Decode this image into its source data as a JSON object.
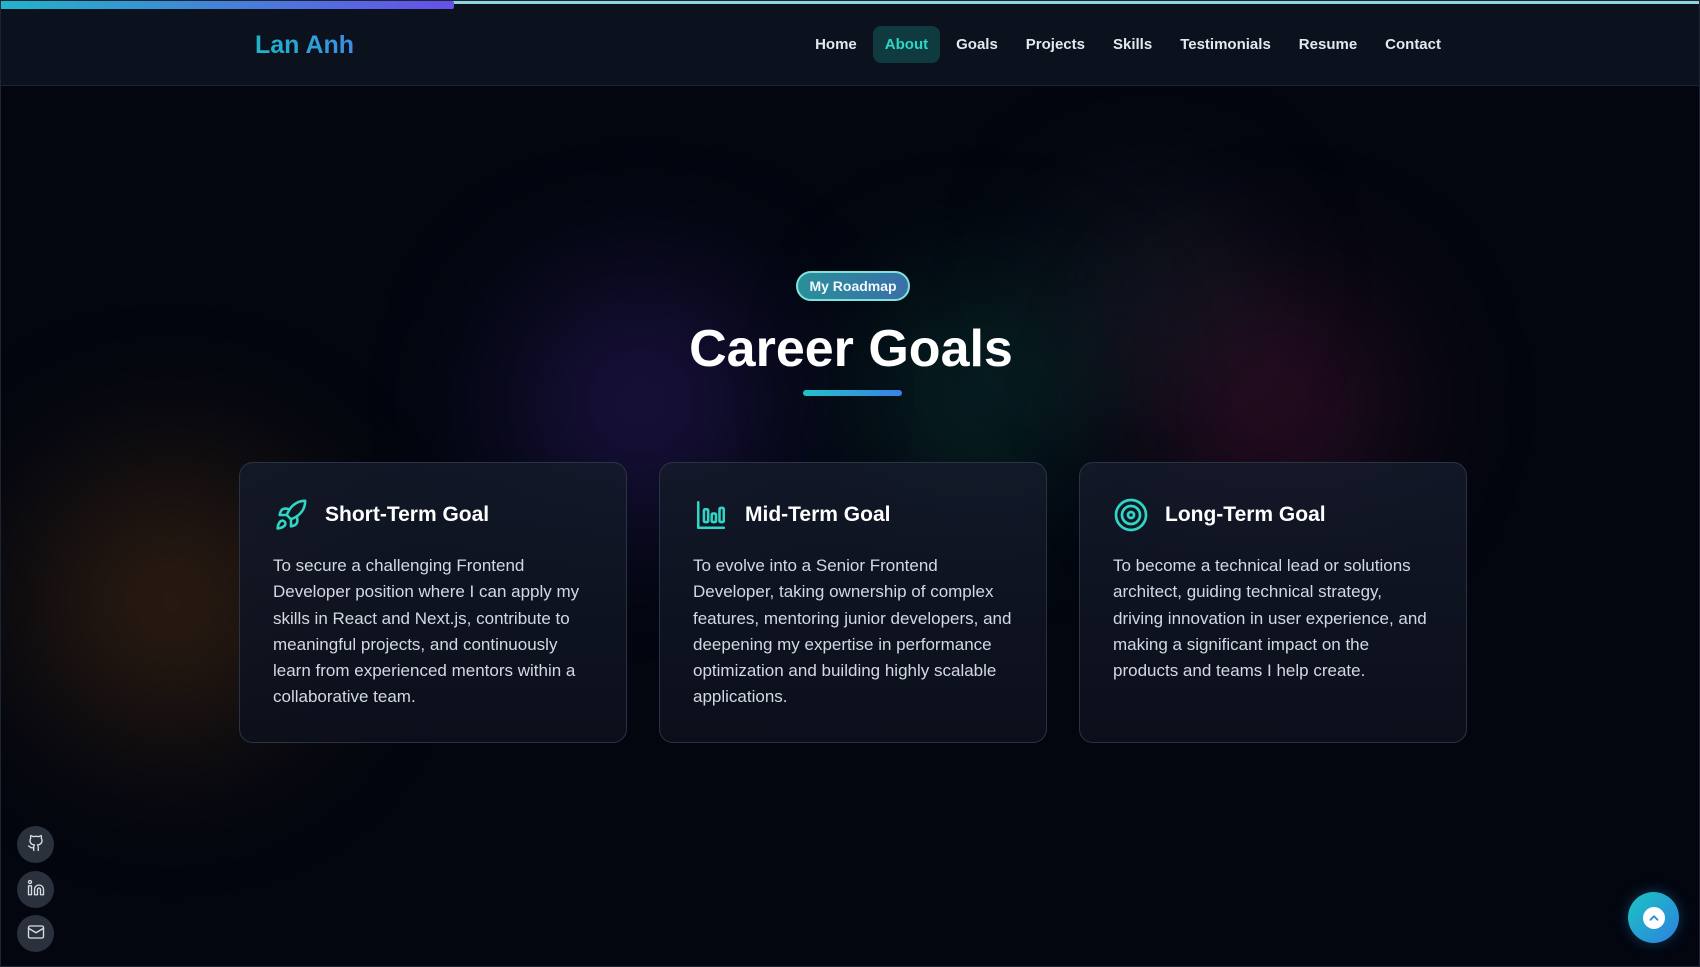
{
  "scroll_progress_percent": 26.7,
  "header": {
    "logo": "Lan Anh",
    "nav": [
      {
        "label": "Home",
        "active": false
      },
      {
        "label": "About",
        "active": true
      },
      {
        "label": "Goals",
        "active": false
      },
      {
        "label": "Projects",
        "active": false
      },
      {
        "label": "Skills",
        "active": false
      },
      {
        "label": "Testimonials",
        "active": false
      },
      {
        "label": "Resume",
        "active": false
      },
      {
        "label": "Contact",
        "active": false
      }
    ]
  },
  "section": {
    "badge": "My Roadmap",
    "title": "Career Goals"
  },
  "goals": [
    {
      "icon": "rocket-icon",
      "title": "Short-Term Goal",
      "text": "To secure a challenging Frontend Developer position where I can apply my skills in React and Next.js, contribute to meaningful projects, and continuously learn from experienced mentors within a collaborative team."
    },
    {
      "icon": "bar-chart-icon",
      "title": "Mid-Term Goal",
      "text": "To evolve into a Senior Frontend Developer, taking ownership of complex features, mentoring junior developers, and deepening my expertise in performance optimization and building highly scalable applications."
    },
    {
      "icon": "target-icon",
      "title": "Long-Term Goal",
      "text": "To become a technical lead or solutions architect, guiding technical strategy, driving innovation in user experience, and making a significant impact on the products and teams I help create."
    }
  ],
  "social": [
    {
      "icon": "github-icon"
    },
    {
      "icon": "linkedin-icon"
    },
    {
      "icon": "mail-icon"
    }
  ],
  "colors": {
    "accent_teal": "#2fd6c4",
    "accent_blue": "#3c7fe6",
    "background": "#03060f"
  }
}
